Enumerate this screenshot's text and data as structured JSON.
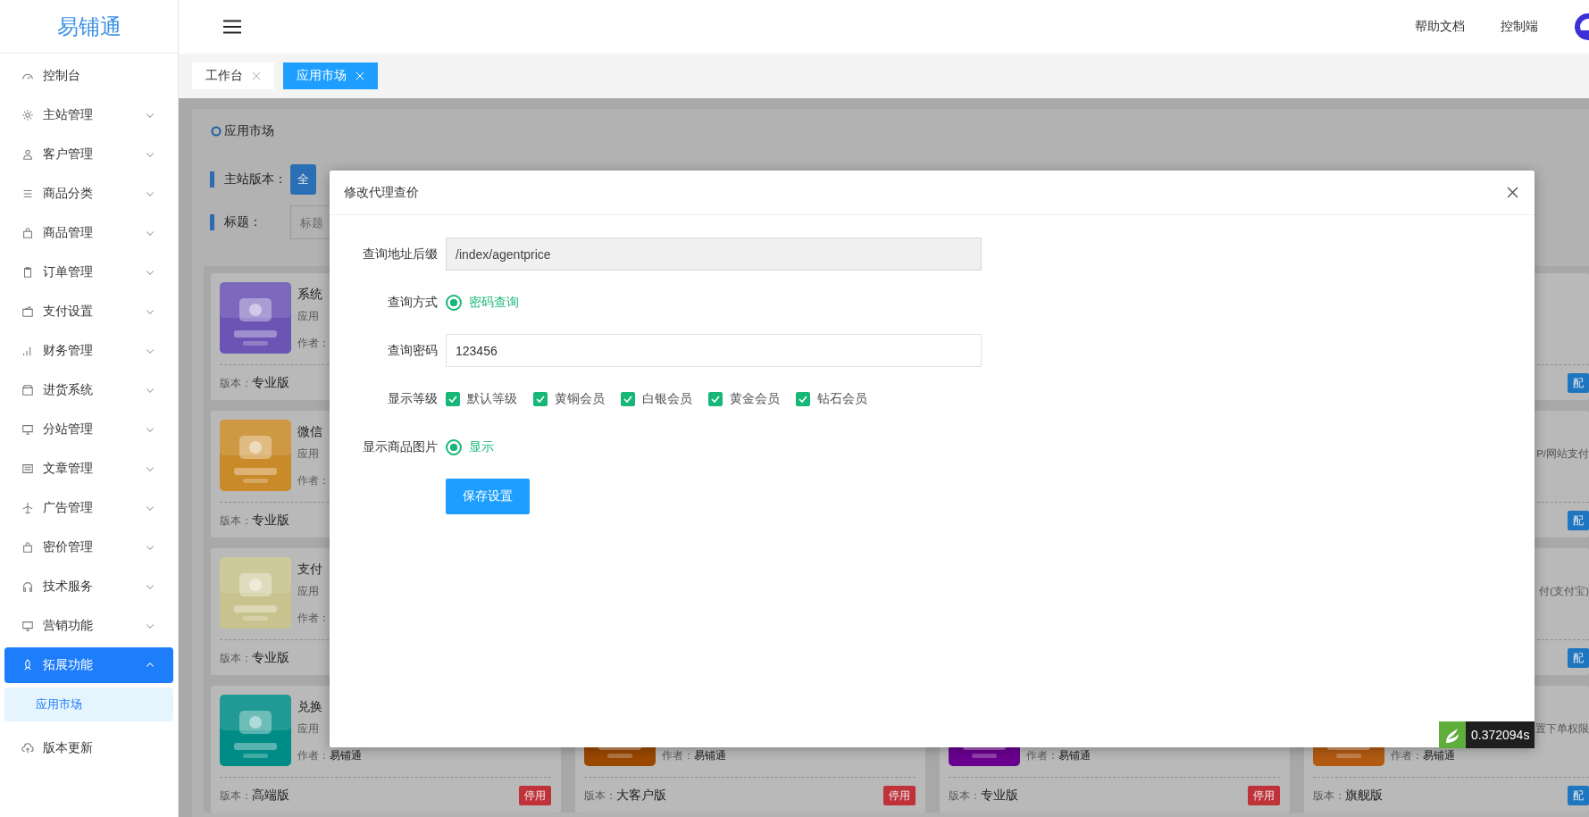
{
  "sidebar": {
    "logo": "易铺通",
    "items": [
      {
        "label": "控制台",
        "selected": false
      },
      {
        "label": "主站管理",
        "selected": false,
        "expanded": false
      },
      {
        "label": "客户管理",
        "selected": false,
        "expanded": false
      },
      {
        "label": "商品分类",
        "selected": false,
        "expanded": false
      },
      {
        "label": "商品管理",
        "selected": false,
        "expanded": false
      },
      {
        "label": "订单管理",
        "selected": false,
        "expanded": false
      },
      {
        "label": "支付设置",
        "selected": false,
        "expanded": false
      },
      {
        "label": "财务管理",
        "selected": false,
        "expanded": false
      },
      {
        "label": "进货系统",
        "selected": false,
        "expanded": false
      },
      {
        "label": "分站管理",
        "selected": false,
        "expanded": false
      },
      {
        "label": "文章管理",
        "selected": false,
        "expanded": false
      },
      {
        "label": "广告管理",
        "selected": false,
        "expanded": false
      },
      {
        "label": "密价管理",
        "selected": false,
        "expanded": false
      },
      {
        "label": "技术服务",
        "selected": false,
        "expanded": false
      },
      {
        "label": "营销功能",
        "selected": false,
        "expanded": false
      },
      {
        "label": "拓展功能",
        "selected": true,
        "expanded": true,
        "children": [
          {
            "label": "应用市场",
            "selected": true
          }
        ]
      },
      {
        "label": "版本更新",
        "selected": false
      }
    ]
  },
  "topbar": {
    "links": [
      "帮助文档",
      "控制端"
    ]
  },
  "tabs": [
    {
      "label": "工作台",
      "selected": false
    },
    {
      "label": "应用市场",
      "selected": true
    }
  ],
  "panel": {
    "title": "应用市场",
    "filters": [
      {
        "label": "主站版本：",
        "kind": "buttons",
        "options": [
          {
            "label": "全",
            "selected": true
          }
        ]
      },
      {
        "label": "标题：",
        "kind": "search",
        "placeholder": "标题"
      }
    ]
  },
  "card_columns": [
    [
      {
        "title": "系统",
        "description": "应用",
        "author": {
          "label": "作者："
        },
        "version": {
          "label": "版本：",
          "value": "专业版"
        },
        "color": "#6a55b5"
      },
      {
        "title": "微信",
        "description": "应用",
        "author": {
          "label": "作者："
        },
        "version": {
          "label": "版本：",
          "value": "专业版"
        },
        "color": "#c98a2a"
      },
      {
        "title": "支付",
        "description": "应用",
        "author": {
          "label": "作者："
        },
        "version": {
          "label": "版本：",
          "value": "专业版"
        },
        "color": "#c8c28e"
      },
      {
        "title": "兑换",
        "description": "应用",
        "author": {
          "label": "作者：",
          "value": "易铺通"
        },
        "version": {
          "label": "版本：",
          "value": "高端版"
        },
        "action": {
          "label": "停用",
          "kind": "disable"
        },
        "color": "#008c86"
      }
    ],
    [
      {
        "author": {
          "label": "作者：",
          "value": "易铺通"
        },
        "version": {
          "label": "版本：",
          "value": "大客户版"
        },
        "action": {
          "label": "停用",
          "kind": "disable"
        },
        "color": "#9a4800"
      }
    ],
    [
      {
        "author": {
          "label": "作者：",
          "value": "易铺通"
        },
        "version": {
          "label": "版本：",
          "value": "专业版"
        },
        "action": {
          "label": "停用",
          "kind": "disable"
        },
        "color": "#6a0090"
      }
    ],
    [
      {
        "action": {
          "label": "配",
          "kind": "configure"
        }
      },
      {
        "description": "P/网站支付",
        "action": {
          "label": "配",
          "kind": "configure"
        }
      },
      {
        "description": "付(支付宝)",
        "action": {
          "label": "配",
          "kind": "configure"
        }
      },
      {
        "description": "置下单权限",
        "author": {
          "label": "作者：",
          "value": "易铺通"
        },
        "version": {
          "label": "版本：",
          "value": "旗舰版"
        },
        "action": {
          "label": "配",
          "kind": "configure"
        },
        "color": "#b25a12"
      }
    ]
  ],
  "modal": {
    "title": "修改代理查价",
    "fields": [
      {
        "label": "查询地址后缀",
        "kind": "text",
        "value": "/index/agentprice",
        "disabled": true
      },
      {
        "label": "查询方式",
        "kind": "radio",
        "options": [
          {
            "label": "密码查询",
            "selected": true
          }
        ]
      },
      {
        "label": "查询密码",
        "kind": "text",
        "value": "123456",
        "disabled": false
      },
      {
        "label": "显示等级",
        "kind": "checkbox",
        "options": [
          {
            "label": "默认等级",
            "checked": true
          },
          {
            "label": "黄铜会员",
            "checked": true
          },
          {
            "label": "白银会员",
            "checked": true
          },
          {
            "label": "黄金会员",
            "checked": true
          },
          {
            "label": "钻石会员",
            "checked": true
          }
        ]
      },
      {
        "label": "显示商品图片",
        "kind": "radio",
        "options": [
          {
            "label": "显示",
            "selected": true
          }
        ]
      }
    ],
    "submit": "保存设置"
  },
  "timer": "0.372094s"
}
